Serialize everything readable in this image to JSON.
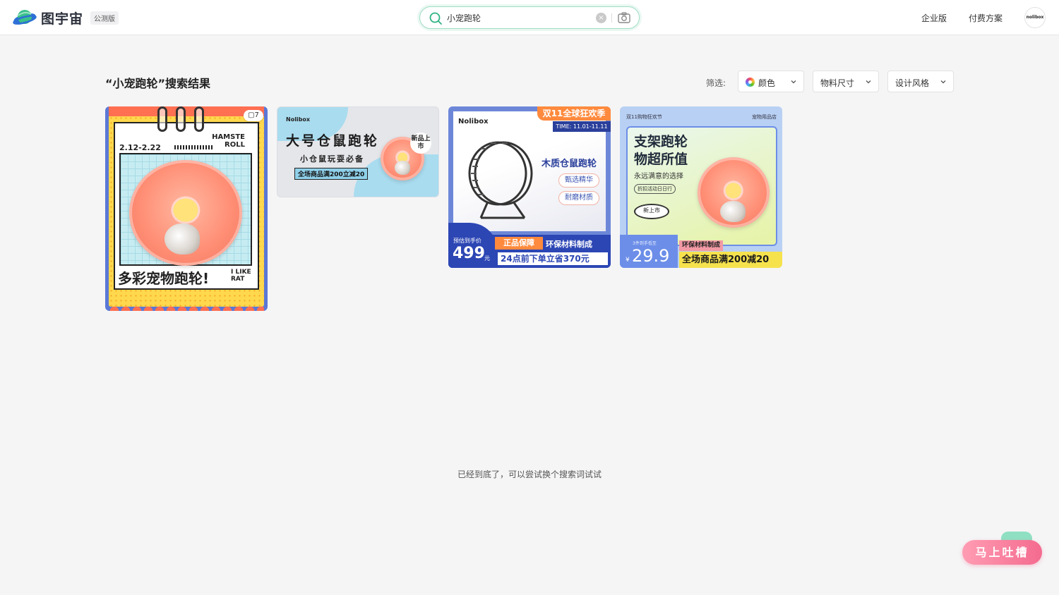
{
  "header": {
    "logo_text": "图宇宙",
    "beta_badge": "公测版",
    "search": {
      "value": "小宠跑轮",
      "clear_icon": "close-circle-icon",
      "camera_icon": "camera-icon"
    },
    "nav": {
      "enterprise": "企业版",
      "pricing": "付费方案"
    },
    "avatar_text": "nolibox"
  },
  "results": {
    "title": "“小宠跑轮”搜索结果",
    "filter_label": "筛选:",
    "filters": [
      {
        "label": "颜色"
      },
      {
        "label": "物料尺寸"
      },
      {
        "label": "设计风格"
      }
    ]
  },
  "cards": [
    {
      "badge": "▢7",
      "date": "2.12-2.22",
      "hamster_text": "HAMSTE ROLL",
      "title": "多彩宠物跑轮!",
      "like_text": "I LIKE RAT"
    },
    {
      "brand": "Nolibox",
      "title": "大号仓鼠跑轮",
      "subtitle": "小仓鼠玩耍必备",
      "promo": "全场商品满200立减20",
      "new_badge": "新品上市"
    },
    {
      "brand": "Nolibox",
      "tag": "双11全球狂欢季",
      "time": "TIME: 11.01-11.11",
      "title": "木质仓鼠跑轮",
      "pill1": "甄选精华",
      "pill2": "耐磨材质",
      "pre_label": "预估到手价",
      "price": "499",
      "unit": "元",
      "guarantee": "正品保障",
      "eco": "环保材料制成",
      "deal": "24点前下单立省370元"
    },
    {
      "head_left": "双11购物狂欢节",
      "head_right": "宠物用品店",
      "title_line1": "支架跑轮",
      "title_line2": "物超所值",
      "subtitle": "永远满意的选择",
      "pill": "折扣活动日日行",
      "disc": "新上市",
      "pre_label": "3件到手低至",
      "currency": "¥",
      "price": "29.9",
      "eco": "环保材料制成",
      "deal": "全场商品满200减20"
    }
  ],
  "end_text": "已经到底了，可以尝试换个搜索词试试",
  "feedback_label": "马上吐槽"
}
